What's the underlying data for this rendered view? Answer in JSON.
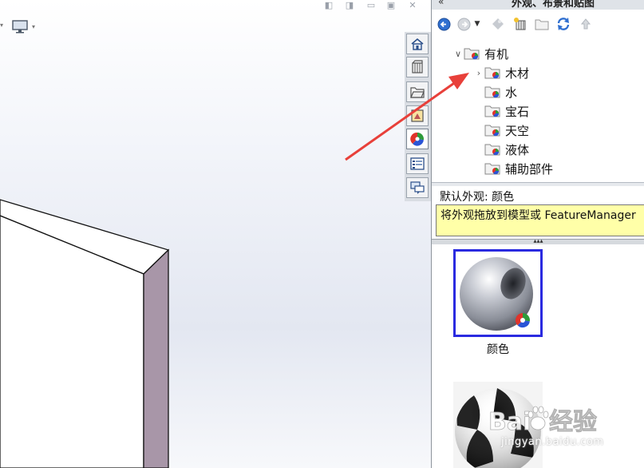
{
  "viewport": {
    "controls": [
      "◧",
      "◨",
      "▭",
      "▣",
      "✕"
    ]
  },
  "taskpane": {
    "title": "外观、布景和贴图",
    "tree": {
      "root": {
        "label": "有机",
        "expanded": true
      },
      "children": [
        {
          "label": "木材",
          "has_children": true
        },
        {
          "label": "水",
          "has_children": false
        },
        {
          "label": "宝石",
          "has_children": false
        },
        {
          "label": "天空",
          "has_children": false
        },
        {
          "label": "液体",
          "has_children": false
        },
        {
          "label": "辅助部件",
          "has_children": false
        }
      ]
    },
    "default_appearance": "默认外观: 颜色",
    "hint": "将外观拖放到模型或 FeatureManager",
    "gallery": [
      {
        "label": "颜色",
        "selected": true
      },
      {
        "label": "",
        "selected": false
      }
    ]
  },
  "tab_strip": [
    "home-icon",
    "design-library-icon",
    "file-explorer-icon",
    "view-palette-icon",
    "appearances-icon",
    "custom-properties-icon",
    "forum-icon"
  ],
  "watermark": {
    "text": "jingyan.baidu.com"
  },
  "colors": {
    "accent_selected": "#2a2ae0",
    "hint_background": "#ffffa8",
    "arrow": "#e8403a",
    "model_side": "#a896a8"
  }
}
